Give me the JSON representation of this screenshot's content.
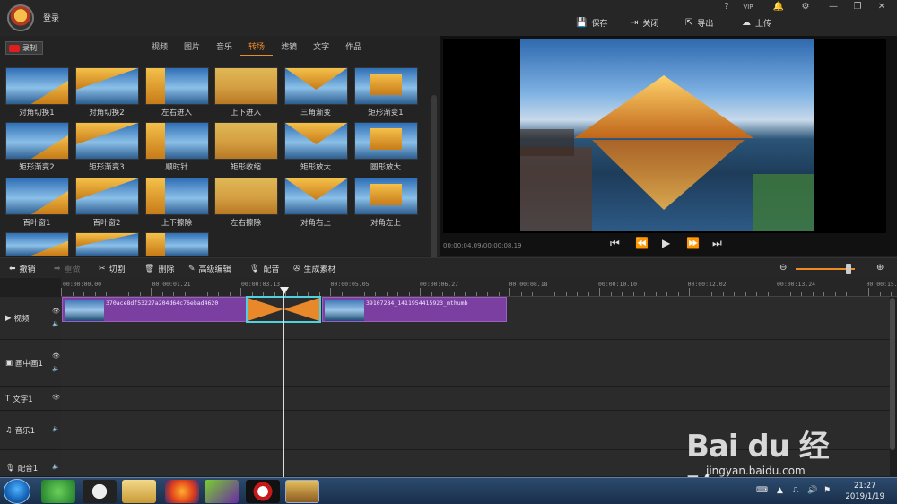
{
  "header": {
    "login": "登录",
    "window_controls": [
      "?",
      "VIP",
      "🔔",
      "⚙",
      "—",
      "❐",
      "✕"
    ],
    "actions": [
      {
        "icon": "save-icon",
        "label": "保存"
      },
      {
        "icon": "close-doc-icon",
        "label": "关闭"
      },
      {
        "icon": "export-icon",
        "label": "导出"
      },
      {
        "icon": "upload-icon",
        "label": "上传"
      }
    ]
  },
  "media": {
    "record_label": "录制",
    "tabs": [
      "视频",
      "图片",
      "音乐",
      "转场",
      "滤镜",
      "文字",
      "作品"
    ],
    "active_tab": "转场",
    "transitions": [
      "对角切换1",
      "对角切换2",
      "左右进入",
      "上下进入",
      "三角渐变",
      "矩形渐变1",
      "矩形渐变2",
      "矩形渐变3",
      "顺时针",
      "矩形收缩",
      "矩形放大",
      "圆形放大",
      "百叶窗1",
      "百叶窗2",
      "上下擦除",
      "左右擦除",
      "对角右上",
      "对角左上"
    ]
  },
  "preview": {
    "timecode": "00:00:04.09/00:00:08.19",
    "controls": [
      "⏮",
      "⏪",
      "▶",
      "⏩",
      "⏭"
    ]
  },
  "edit_toolbar": {
    "undo": "撤销",
    "redo": "重做",
    "cut": "切割",
    "delete": "删除",
    "advanced": "高级编辑",
    "dub": "配音",
    "generate": "生成素材",
    "zoom_level": 0.9
  },
  "timeline": {
    "ruler": [
      "00:00:00.00",
      "00:00:01.21",
      "00:00:03.13",
      "00:00:05.05",
      "00:00:06.27",
      "00:00:08.18",
      "00:00:10.10",
      "00:00:12.02",
      "00:00:13.24",
      "00:00:15.1"
    ],
    "tracks": [
      {
        "label": "视频",
        "icon": "play-icon"
      },
      {
        "label": "画中画1",
        "icon": "pip-icon"
      },
      {
        "label": "文字1",
        "icon": "text-icon"
      },
      {
        "label": "音乐1",
        "icon": "music-icon"
      },
      {
        "label": "配音1",
        "icon": "mic-icon"
      }
    ],
    "clips": [
      {
        "name": "370ace8df53227a204d64c76ebad4620"
      },
      {
        "name": "39107284_1411954415923_mthumb"
      }
    ]
  },
  "taskbar": {
    "time": "21:27",
    "date": "2019/1/19"
  },
  "watermark": {
    "main": "Bai du 经验",
    "sub": "jingyan.baidu.com"
  }
}
